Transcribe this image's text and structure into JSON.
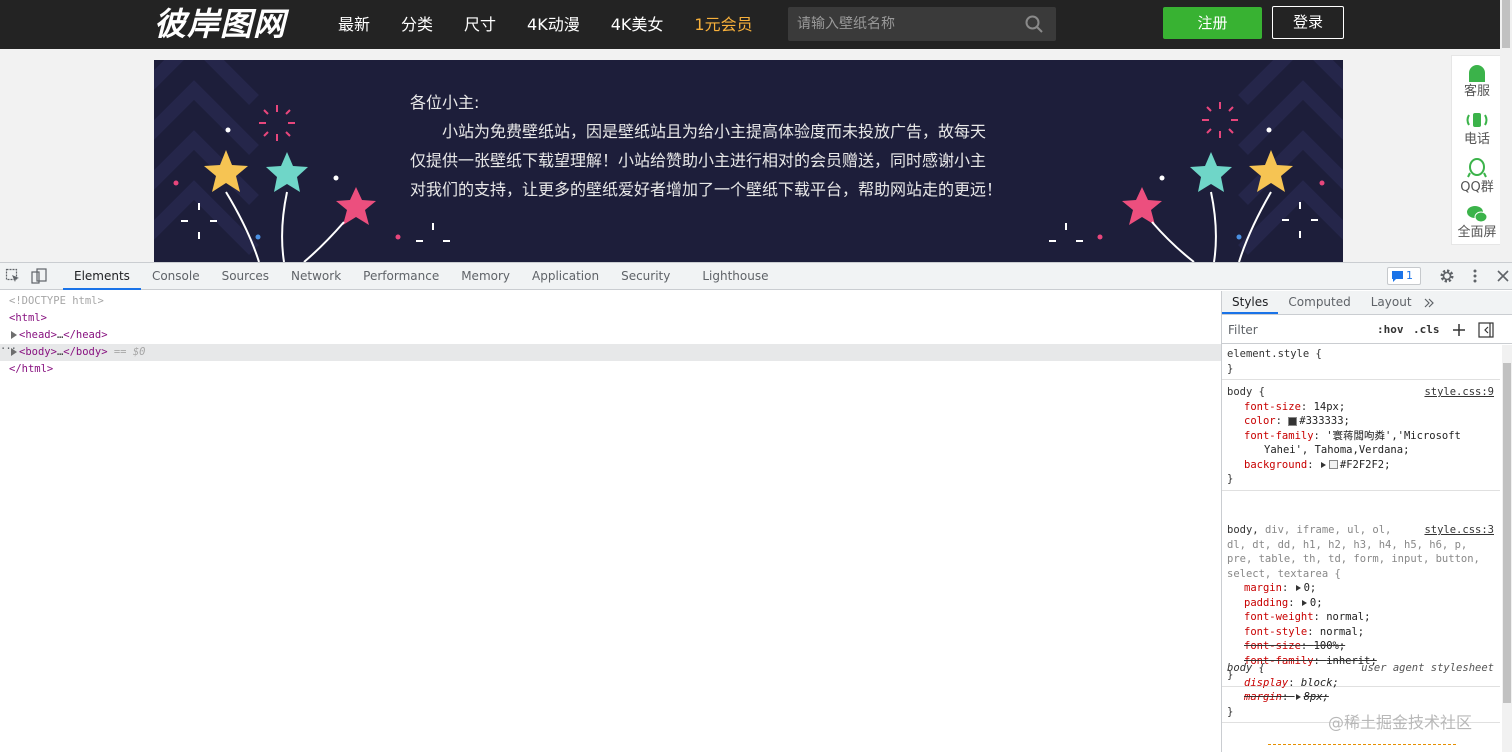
{
  "site": {
    "logo": "彼岸图网",
    "nav": [
      "最新",
      "分类",
      "尺寸",
      "4K动漫",
      "4K美女",
      "1元会员"
    ],
    "search_placeholder": "请输入壁纸名称",
    "register": "注册",
    "login": "登录",
    "banner": {
      "line1": "各位小主:",
      "line2": "小站为免费壁纸站，因是壁纸站且为给小主提高体验度而未投放广告，故每天",
      "line3": "仅提供一张壁纸下载望理解！小站给赞助小主进行相对的会员赠送，同时感谢小主",
      "line4": "对我们的支持，让更多的壁纸爱好者增加了一个壁纸下载平台，帮助网站走的更远！"
    },
    "side_tools": [
      "客服",
      "电话",
      "QQ群",
      "全面屏"
    ]
  },
  "devtools": {
    "tabs": [
      "Elements",
      "Console",
      "Sources",
      "Network",
      "Performance",
      "Memory",
      "Application",
      "Security",
      "Lighthouse"
    ],
    "issues_count": "1",
    "dom": {
      "doctype": "<!DOCTYPE html>",
      "html_open": "<html>",
      "head": "<head>",
      "head_ellipsis": "…",
      "head_close": "</head>",
      "body": "<body>",
      "body_ellipsis": "…",
      "body_close": "</body>",
      "sel_marker": "== $0",
      "html_close": "</html>"
    },
    "styles_tabs": [
      "Styles",
      "Computed",
      "Layout"
    ],
    "filter_placeholder": "Filter",
    "hov": ":hov",
    "cls": ".cls",
    "rules": {
      "element_style": {
        "selector": "element.style {",
        "close": "}"
      },
      "body1": {
        "selector": "body {",
        "source": "style.css:9",
        "font_size": {
          "name": "font-size",
          "value": "14px;"
        },
        "color": {
          "name": "color",
          "value": "#333333;"
        },
        "font_family": {
          "name": "font-family",
          "value": "'寰蒋闆呴粦','Microsoft",
          "value2": "Yahei', Tahoma,Verdana;"
        },
        "background": {
          "name": "background",
          "value": "#F2F2F2;"
        },
        "close": "}"
      },
      "reset": {
        "selector_body": "body,",
        "selector_rest": "div, iframe, ul, ol,",
        "selector_line2": "dl, dt, dd, h1, h2, h3, h4, h5, h6, p,",
        "selector_line3": "pre, table, th, td, form, input, button,",
        "selector_line4": "select, textarea {",
        "source": "style.css:3",
        "margin": {
          "name": "margin",
          "value": "0;"
        },
        "padding": {
          "name": "padding",
          "value": "0;"
        },
        "font_weight": {
          "name": "font-weight",
          "value": "normal;"
        },
        "font_style": {
          "name": "font-style",
          "value": "normal;"
        },
        "font_size": {
          "name": "font-size",
          "value": "100%;"
        },
        "font_family": {
          "name": "font-family",
          "value": "inherit;"
        },
        "close": "}"
      },
      "ua": {
        "selector": "body {",
        "source": "user agent stylesheet",
        "display": {
          "name": "display",
          "value": "block;"
        },
        "margin": {
          "name": "margin",
          "value": "8px;"
        },
        "close": "}"
      }
    }
  },
  "watermark": "@稀土掘金技术社区",
  "colors": {
    "site_topbar": "#232323",
    "register_green": "#38b232",
    "vip_orange": "#f7b03b",
    "banner_bg": "#1d1e3a",
    "devtools_accent": "#1a73e8",
    "css_prop_red": "#c80000",
    "tag_purple": "#881280"
  }
}
